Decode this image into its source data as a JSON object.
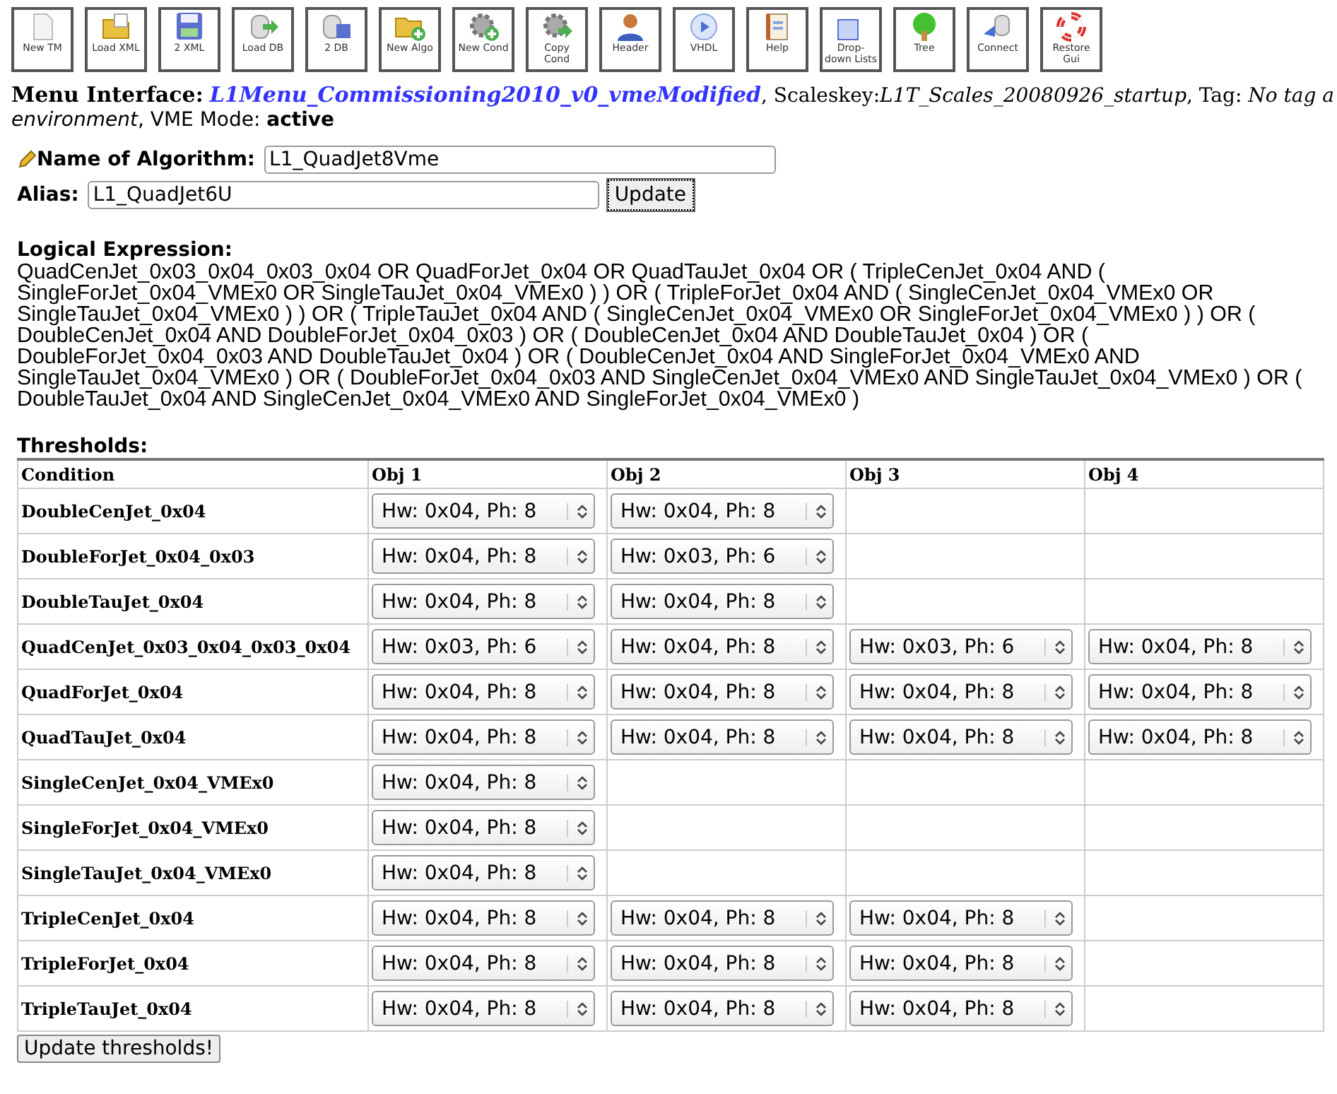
{
  "toolbar": [
    {
      "label": "New TM",
      "kind": "document"
    },
    {
      "label": "Load XML",
      "kind": "folder"
    },
    {
      "label": "2 XML",
      "kind": "floppy"
    },
    {
      "label": "Load DB",
      "kind": "dbarrow"
    },
    {
      "label": "2 DB",
      "kind": "dbfloppy"
    },
    {
      "label": "New Algo",
      "kind": "folderplus"
    },
    {
      "label": "New Cond",
      "kind": "gearplus"
    },
    {
      "label": "Copy Cond",
      "kind": "geararrow"
    },
    {
      "label": "Header",
      "kind": "person"
    },
    {
      "label": "VHDL",
      "kind": "play"
    },
    {
      "label": "Help",
      "kind": "notebook"
    },
    {
      "label": "Drop-down Lists",
      "kind": "list"
    },
    {
      "label": "Tree",
      "kind": "tree"
    },
    {
      "label": "Connect",
      "kind": "connect"
    },
    {
      "label": "Restore Gui",
      "kind": "lifebuoy"
    }
  ],
  "header": {
    "label": "Menu Interface:",
    "menu_link": "L1Menu_Commissioning2010_v0_vmeModified",
    "line1_rest": ", Scaleskey:*L1T_Scales_20080926_startup*, Tag: *No tag a*",
    "line2": "*environment*, VME Mode: **active**"
  },
  "algorithm": {
    "name_label": "Name of Algorithm:",
    "name_value": "L1_QuadJet8Vme",
    "alias_label": "Alias:",
    "alias_value": "L1_QuadJet6U",
    "update_button": "Update"
  },
  "logical_expression": {
    "label": "Logical Expression:",
    "text": "QuadCenJet_0x03_0x04_0x03_0x04 OR QuadForJet_0x04 OR QuadTauJet_0x04 OR ( TripleCenJet_0x04 AND ( SingleForJet_0x04_VMEx0 OR SingleTauJet_0x04_VMEx0 ) ) OR ( TripleForJet_0x04 AND ( SingleCenJet_0x04_VMEx0 OR SingleTauJet_0x04_VMEx0 ) ) OR ( TripleTauJet_0x04 AND ( SingleCenJet_0x04_VMEx0 OR SingleForJet_0x04_VMEx0 ) ) OR ( DoubleCenJet_0x04 AND DoubleForJet_0x04_0x03 ) OR ( DoubleCenJet_0x04 AND DoubleTauJet_0x04 ) OR ( DoubleForJet_0x04_0x03 AND DoubleTauJet_0x04 ) OR ( DoubleCenJet_0x04 AND SingleForJet_0x04_VMEx0 AND SingleTauJet_0x04_VMEx0 ) OR ( DoubleForJet_0x04_0x03 AND SingleCenJet_0x04_VMEx0 AND SingleTauJet_0x04_VMEx0 ) OR ( DoubleTauJet_0x04 AND SingleCenJet_0x04_VMEx0 AND SingleForJet_0x04_VMEx0 )"
  },
  "thresholds": {
    "label": "Thresholds:",
    "columns": [
      "Condition",
      "Obj 1",
      "Obj 2",
      "Obj 3",
      "Obj 4"
    ],
    "rows": [
      {
        "condition": "DoubleCenJet_0x04",
        "objects": [
          "Hw: 0x04, Ph: 8",
          "Hw: 0x04, Ph: 8"
        ]
      },
      {
        "condition": "DoubleForJet_0x04_0x03",
        "objects": [
          "Hw: 0x04, Ph: 8",
          "Hw: 0x03, Ph: 6"
        ]
      },
      {
        "condition": "DoubleTauJet_0x04",
        "objects": [
          "Hw: 0x04, Ph: 8",
          "Hw: 0x04, Ph: 8"
        ]
      },
      {
        "condition": "QuadCenJet_0x03_0x04_0x03_0x04",
        "objects": [
          "Hw: 0x03, Ph: 6",
          "Hw: 0x04, Ph: 8",
          "Hw: 0x03, Ph: 6",
          "Hw: 0x04, Ph: 8"
        ]
      },
      {
        "condition": "QuadForJet_0x04",
        "objects": [
          "Hw: 0x04, Ph: 8",
          "Hw: 0x04, Ph: 8",
          "Hw: 0x04, Ph: 8",
          "Hw: 0x04, Ph: 8"
        ]
      },
      {
        "condition": "QuadTauJet_0x04",
        "objects": [
          "Hw: 0x04, Ph: 8",
          "Hw: 0x04, Ph: 8",
          "Hw: 0x04, Ph: 8",
          "Hw: 0x04, Ph: 8"
        ]
      },
      {
        "condition": "SingleCenJet_0x04_VMEx0",
        "objects": [
          "Hw: 0x04, Ph: 8"
        ]
      },
      {
        "condition": "SingleForJet_0x04_VMEx0",
        "objects": [
          "Hw: 0x04, Ph: 8"
        ]
      },
      {
        "condition": "SingleTauJet_0x04_VMEx0",
        "objects": [
          "Hw: 0x04, Ph: 8"
        ]
      },
      {
        "condition": "TripleCenJet_0x04",
        "objects": [
          "Hw: 0x04, Ph: 8",
          "Hw: 0x04, Ph: 8",
          "Hw: 0x04, Ph: 8"
        ]
      },
      {
        "condition": "TripleForJet_0x04",
        "objects": [
          "Hw: 0x04, Ph: 8",
          "Hw: 0x04, Ph: 8",
          "Hw: 0x04, Ph: 8"
        ]
      },
      {
        "condition": "TripleTauJet_0x04",
        "objects": [
          "Hw: 0x04, Ph: 8",
          "Hw: 0x04, Ph: 8",
          "Hw: 0x04, Ph: 8"
        ]
      }
    ],
    "update_button": "Update thresholds!"
  }
}
